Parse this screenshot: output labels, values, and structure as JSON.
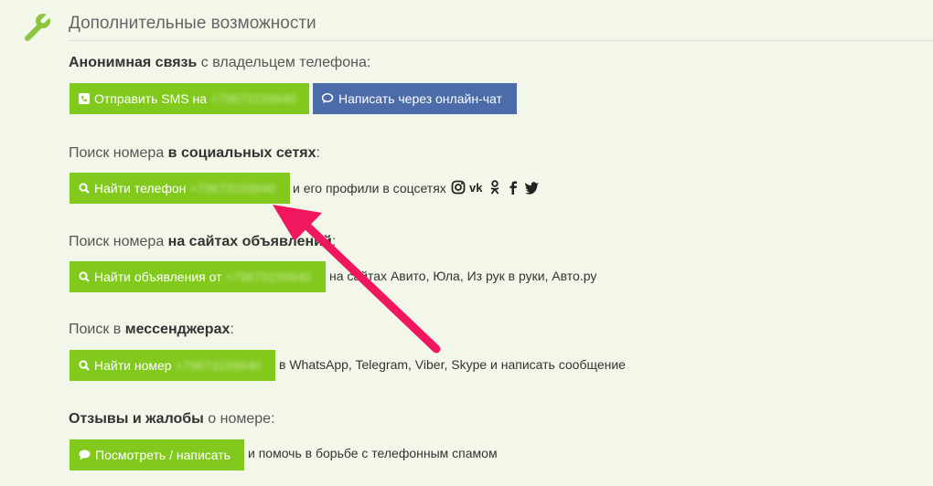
{
  "section": {
    "title": "Дополнительные возможности"
  },
  "anon": {
    "label_bold": "Анонимная связь",
    "label_rest": " с владельцем телефона:",
    "sms_button": "Отправить SMS на",
    "sms_number": "+79673159940",
    "chat_button": "Написать через онлайн-чат"
  },
  "social": {
    "label_pre": "Поиск номера ",
    "label_bold": "в социальных сетях",
    "label_post": ":",
    "button": "Найти телефон",
    "number": "+79673159940",
    "desc": "и его профили в соцсетях",
    "icons": [
      "instagram-icon",
      "vk-icon",
      "odnoklassniki-icon",
      "facebook-icon",
      "twitter-icon"
    ]
  },
  "ads": {
    "label_pre": "Поиск номера ",
    "label_bold": "на сайтах объявлений",
    "label_post": ":",
    "button": "Найти объявления от",
    "number": "+79673159940",
    "desc": "на сайтах Авито, Юла, Из рук в руки, Авто.ру"
  },
  "messengers": {
    "label_pre": "Поиск в ",
    "label_bold": "мессенджерах",
    "label_post": ":",
    "button": "Найти номер",
    "number": "+79673159940",
    "desc": "в WhatsApp, Telegram, Viber, Skype и написать сообщение"
  },
  "reviews": {
    "label_bold": "Отзывы и жалобы",
    "label_rest": " о номере:",
    "button": "Посмотреть / написать",
    "desc": "и помочь в борьбе с телефонным спамом"
  },
  "colors": {
    "green": "#82c91e",
    "blue": "#4b6ca8",
    "arrow": "#f0175f"
  }
}
